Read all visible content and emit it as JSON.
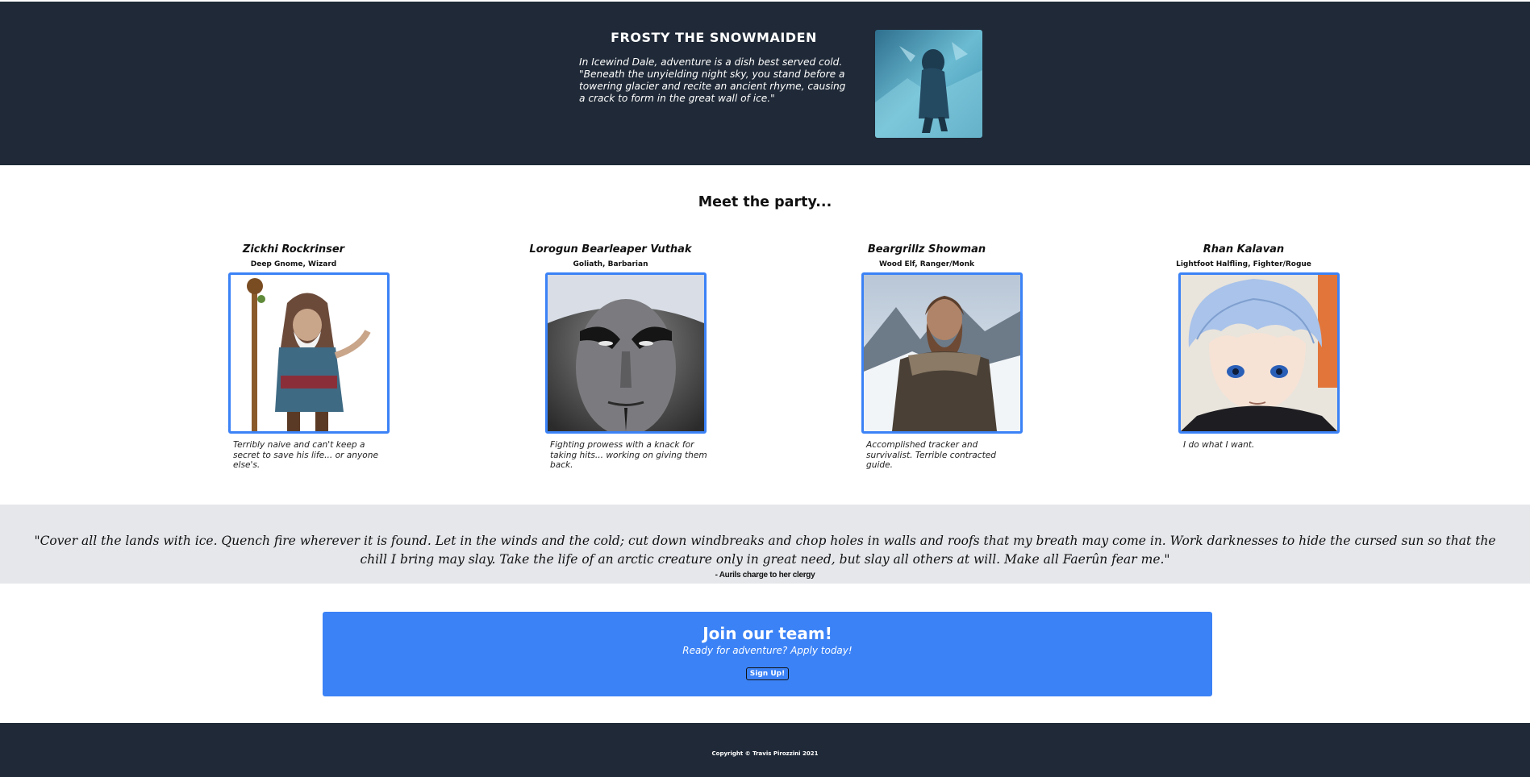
{
  "hero": {
    "title": "FROSTY THE SNOWMAIDEN",
    "text": "In Icewind Dale, adventure is a dish best served cold. \"Beneath the unyielding night sky, you stand before a towering glacier and recite an ancient rhyme, causing a crack to form in the great wall of ice.\""
  },
  "party": {
    "heading": "Meet the party...",
    "members": [
      {
        "name": "Zickhi Rockrinser",
        "class": "Deep Gnome, Wizard",
        "desc": "Terribly naive and can't keep a secret to save his life... or anyone else's."
      },
      {
        "name": "Lorogun Bearleaper Vuthak",
        "class": "Goliath, Barbarian",
        "desc": "Fighting prowess with a knack for taking hits... working on giving them back."
      },
      {
        "name": "Beargrillz Showman",
        "class": "Wood Elf, Ranger/Monk",
        "desc": "Accomplished tracker and survivalist. Terrible contracted guide."
      },
      {
        "name": "Rhan Kalavan",
        "class": "Lightfoot Halfling, Fighter/Rogue",
        "desc": "I do what I want."
      }
    ]
  },
  "quote": {
    "text": "\"Cover all the lands with ice. Quench fire wherever it is found. Let in the winds and the cold; cut down windbreaks and chop holes in walls and roofs that my breath may come in. Work darknesses to hide the cursed sun so that the chill I bring may slay. Take the life of an arctic creature only in great need, but slay all others at will. Make all Faerûn fear me.\"",
    "attribution": "- Aurils charge to her clergy"
  },
  "cta": {
    "title": "Join our team!",
    "subtitle": "Ready for adventure? Apply today!",
    "button_label": "Sign Up!"
  },
  "footer": {
    "text": "Copyright © Travis Pirozzini 2021"
  },
  "colors": {
    "dark": "#1f2937",
    "accent": "#3b82f6",
    "band": "#e5e7eb"
  }
}
